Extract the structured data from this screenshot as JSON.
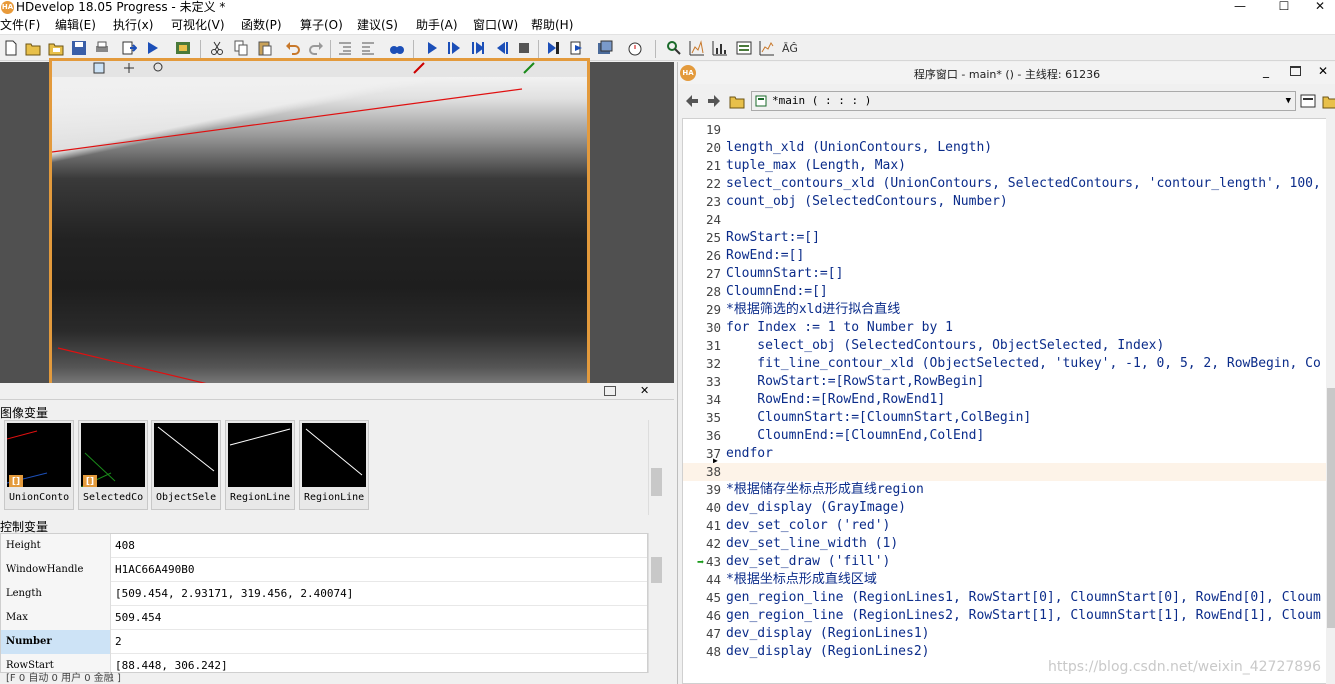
{
  "window": {
    "title": "HDevelop 18.05 Progress - 未定义 *",
    "min": "—",
    "max": "☐",
    "close": "✕"
  },
  "menu": [
    "文件(F)",
    "编辑(E)",
    "执行(x)",
    "可视化(V)",
    "函数(P)",
    "算子(O)",
    "建议(S)",
    "助手(A)",
    "窗口(W)",
    "帮助(H)"
  ],
  "panels": {
    "image_vars_title": "图像变量",
    "image_vars": [
      "UnionConto",
      "SelectedCo",
      "ObjectSele",
      "RegionLine",
      "RegionLine"
    ],
    "control_vars_title": "控制变量",
    "control_vars": [
      {
        "name": "Height",
        "value": "408"
      },
      {
        "name": "WindowHandle",
        "value": "H1AC66A490B0"
      },
      {
        "name": "Length",
        "value": "[509.454, 2.93171, 319.456, 2.40074]"
      },
      {
        "name": "Max",
        "value": "509.454"
      },
      {
        "name": "Number",
        "value": "2"
      },
      {
        "name": "RowStart",
        "value": "[88.448, 306.242]"
      }
    ],
    "status": "[F 0 自动 0 用户 0 金融 ]"
  },
  "program": {
    "title": "程序窗口 - main* () - 主线程: 61236",
    "procedure": "*main ( : : : )",
    "lines": [
      {
        "n": "19",
        "t": ""
      },
      {
        "n": "20",
        "t": "length_xld (UnionContours, Length)"
      },
      {
        "n": "21",
        "t": "tuple_max (Length, Max)"
      },
      {
        "n": "22",
        "t": "select_contours_xld (UnionContours, SelectedContours, 'contour_length', 100,"
      },
      {
        "n": "23",
        "t": "count_obj (SelectedContours, Number)"
      },
      {
        "n": "24",
        "t": ""
      },
      {
        "n": "25",
        "t": "RowStart:=[]"
      },
      {
        "n": "26",
        "t": "RowEnd:=[]"
      },
      {
        "n": "27",
        "t": "CloumnStart:=[]"
      },
      {
        "n": "28",
        "t": "CloumnEnd:=[]"
      },
      {
        "n": "29",
        "t": "*根据筛选的xld进行拟合直线",
        "cls": "c-cm"
      },
      {
        "n": "30",
        "t": "for Index := 1 to Number by 1",
        "cls": "c-kw"
      },
      {
        "n": "31",
        "t": "    select_obj (SelectedContours, ObjectSelected, Index)"
      },
      {
        "n": "32",
        "t": "    fit_line_contour_xld (ObjectSelected, 'tukey', -1, 0, 5, 2, RowBegin, Co"
      },
      {
        "n": "33",
        "t": "    RowStart:=[RowStart,RowBegin]"
      },
      {
        "n": "34",
        "t": "    RowEnd:=[RowEnd,RowEnd1]"
      },
      {
        "n": "35",
        "t": "    CloumnStart:=[CloumnStart,ColBegin]"
      },
      {
        "n": "36",
        "t": "    CloumnEnd:=[CloumnEnd,ColEnd]"
      },
      {
        "n": "37",
        "t": "endfor",
        "cls": "c-kw"
      },
      {
        "n": "38",
        "t": "",
        "hl": true
      },
      {
        "n": "39",
        "t": "*根据储存坐标点形成直线region",
        "cls": "c-cm"
      },
      {
        "n": "40",
        "t": "dev_display (GrayImage)"
      },
      {
        "n": "41",
        "t": "dev_set_color ('red')"
      },
      {
        "n": "42",
        "t": "dev_set_line_width (1)"
      },
      {
        "n": "43",
        "t": "dev_set_draw ('fill')"
      },
      {
        "n": "44",
        "t": "*根据坐标点形成直线区域",
        "cls": "c-cm"
      },
      {
        "n": "45",
        "t": "gen_region_line (RegionLines1, RowStart[0], CloumnStart[0], RowEnd[0], Cloum"
      },
      {
        "n": "46",
        "t": "gen_region_line (RegionLines2, RowStart[1], CloumnStart[1], RowEnd[1], Cloum"
      },
      {
        "n": "47",
        "t": "dev_display (RegionLines1)"
      },
      {
        "n": "48",
        "t": "dev_display (RegionLines2)"
      }
    ],
    "watermark": "https://blog.csdn.net/weixin_42727896"
  },
  "colors": {
    "accent": "#e39a3c",
    "code": "#0b2c8a",
    "comment": "#1a8a1a",
    "keyword": "#2aa7d8",
    "fitline": "#e01010"
  }
}
